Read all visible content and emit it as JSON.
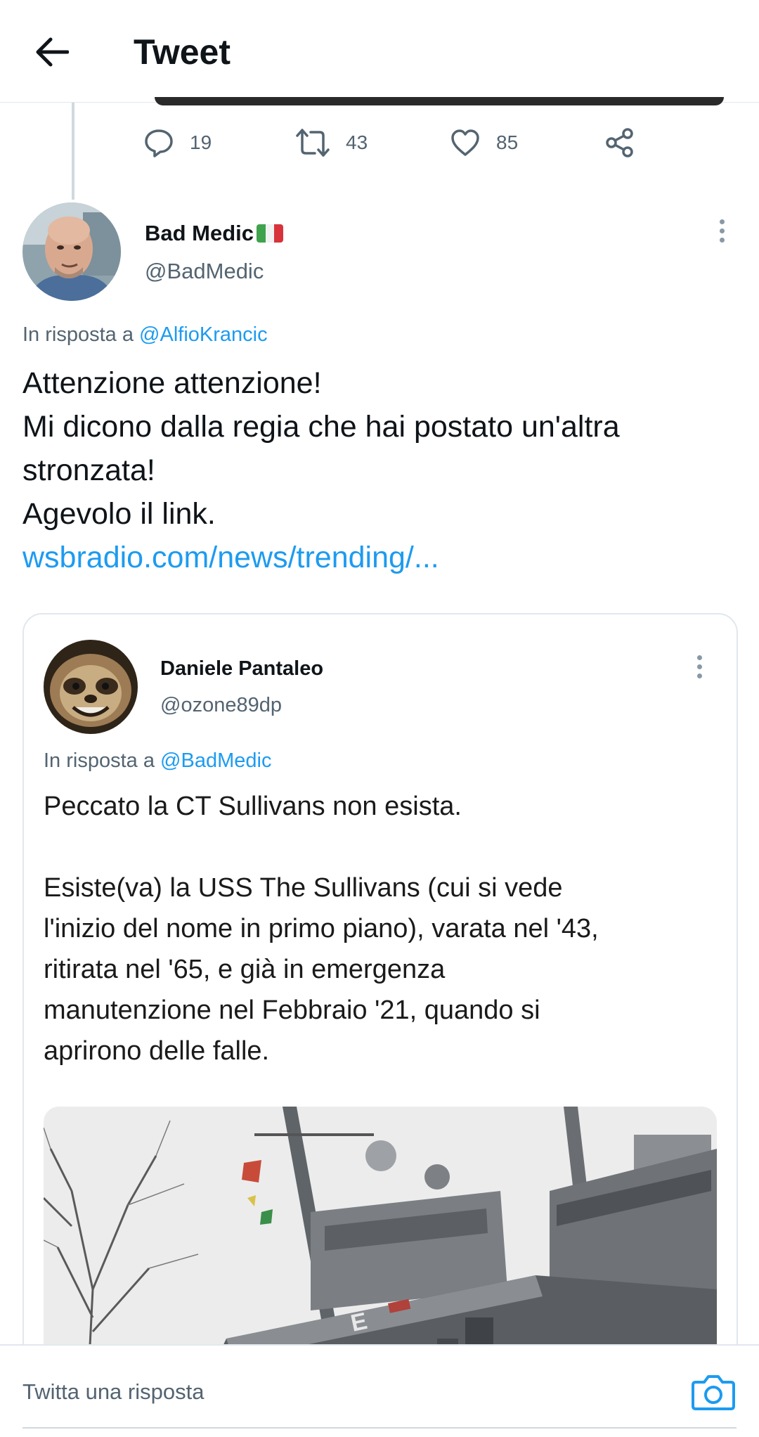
{
  "header": {
    "title": "Tweet"
  },
  "prev_tweet": {
    "actions": {
      "replies": "19",
      "retweets": "43",
      "likes": "85"
    }
  },
  "tweet": {
    "author": {
      "name": "Bad Medic",
      "handle": "@BadMedic"
    },
    "reply_prefix": "In risposta a",
    "reply_mention": "@AlfioKrancic",
    "lines": [
      "Attenzione attenzione!",
      "Mi dicono dalla regia che hai postato un'altra",
      "stronzata!",
      "Agevolo il link."
    ],
    "link": "wsbradio.com/news/trending/..."
  },
  "quoted": {
    "author": {
      "name": "Daniele Pantaleo",
      "handle": "@ozone89dp"
    },
    "reply_prefix": "In risposta a",
    "reply_mention": "@BadMedic",
    "lines": [
      "Peccato la CT Sullivans non esista.",
      "",
      "Esiste(va) la USS The Sullivans (cui si vede",
      "l'inizio del nome in primo piano), varata nel '43,",
      "ritirata nel '65, e già in emergenza",
      "manutenzione nel Febbraio '21, quando si",
      "aprirono delle falle."
    ]
  },
  "reply_bar": {
    "placeholder": "Twitta una risposta"
  },
  "colors": {
    "accent": "#1d9bf0",
    "secondary_text": "#536471",
    "border": "#e1e8ed"
  },
  "icons": [
    "back-arrow-icon",
    "reply-icon",
    "retweet-icon",
    "like-icon",
    "share-icon",
    "more-icon",
    "italy-flag-icon",
    "camera-icon"
  ]
}
